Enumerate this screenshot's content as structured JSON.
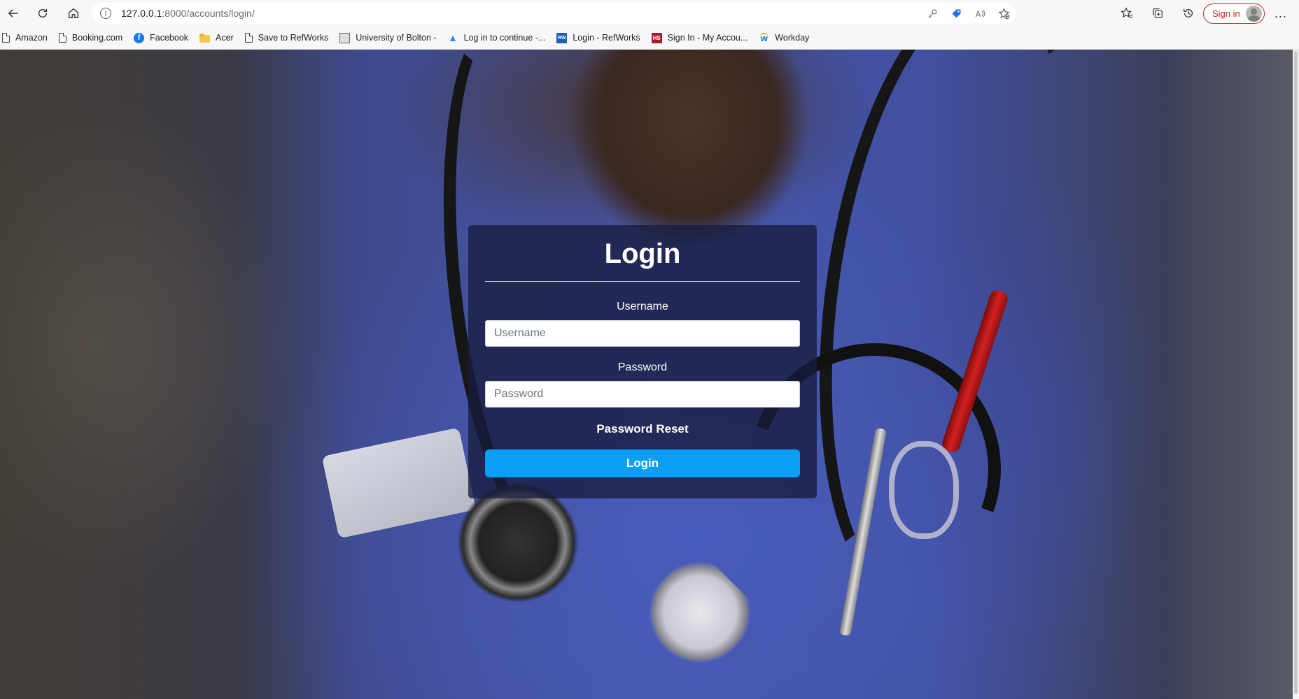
{
  "browser": {
    "url_host": "127.0.0.1",
    "url_path": ":8000/accounts/login/",
    "signin_label": "Sign in",
    "accent_color": "#c42b1c",
    "nav_icons": [
      "back-icon",
      "refresh-icon",
      "home-icon"
    ],
    "url_icons": [
      "key-icon",
      "shopping-tag-icon",
      "read-aloud-icon",
      "add-favorite-icon"
    ],
    "tool_icons": [
      "favorites-icon",
      "collections-icon",
      "history-icon"
    ],
    "more_label": "..."
  },
  "bookmarks": [
    {
      "label": "Amazon",
      "icon": "page-icon"
    },
    {
      "label": "Booking.com",
      "icon": "page-icon"
    },
    {
      "label": "Facebook",
      "icon": "facebook-icon"
    },
    {
      "label": "Acer",
      "icon": "folder-icon"
    },
    {
      "label": "Save to RefWorks",
      "icon": "page-icon"
    },
    {
      "label": "University of Bolton -",
      "icon": "university-icon"
    },
    {
      "label": "Log in to continue -...",
      "icon": "atlassian-icon"
    },
    {
      "label": "Login - RefWorks",
      "icon": "refworks-icon"
    },
    {
      "label": "Sign In - My Accou...",
      "icon": "harvard-icon"
    },
    {
      "label": "Workday",
      "icon": "workday-icon"
    }
  ],
  "login": {
    "title": "Login",
    "username_label": "Username",
    "username_placeholder": "Username",
    "username_value": "",
    "password_label": "Password",
    "password_placeholder": "Password",
    "password_value": "",
    "reset_label": "Password Reset",
    "submit_label": "Login",
    "button_color": "#0a9ef5"
  }
}
